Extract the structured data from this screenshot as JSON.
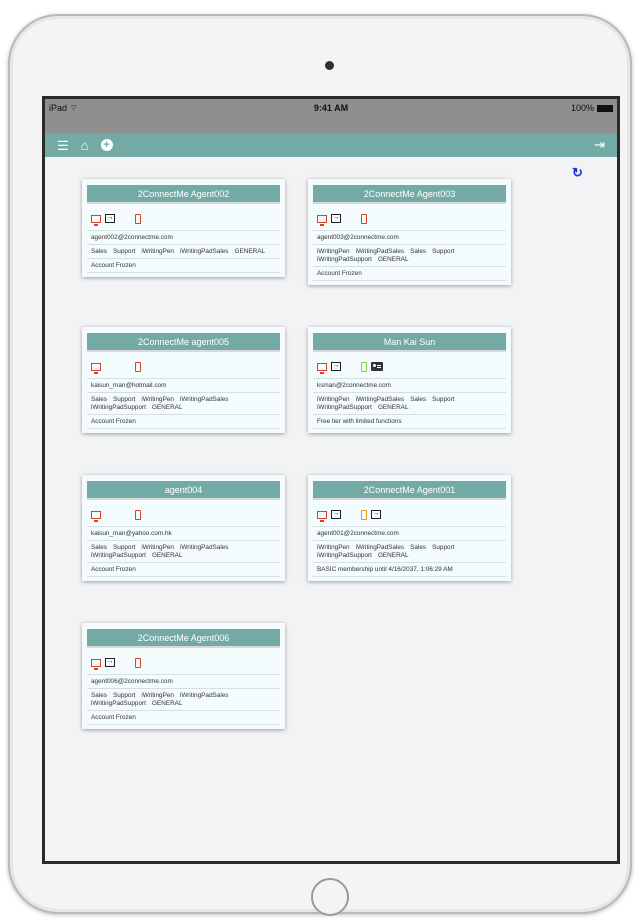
{
  "status_bar": {
    "device": "iPad",
    "time": "9:41 AM",
    "battery": "100%"
  },
  "toolbar": {
    "menu_icon": "menu-icon",
    "home_icon": "home-icon",
    "add_icon": "add-circle-icon",
    "logout_icon": "sign-out-icon"
  },
  "refresh_icon": "refresh-icon",
  "cards": [
    {
      "title": "2ConnectMe Agent002",
      "email": "agent002@2connectme.com",
      "groups": [
        "Sales",
        "Support",
        "iWritingPen",
        "iWritingPadSales",
        "GENERAL"
      ],
      "status": "Account Frozen"
    },
    {
      "title": "2ConnectMe Agent003",
      "email": "agent003@2connectme.com",
      "groups": [
        "iWritingPen",
        "iWritingPadSales",
        "Sales",
        "Support",
        "iWritingPadSupport",
        "GENERAL"
      ],
      "status": "Account Frozen"
    },
    {
      "title": "2ConnectMe agent005",
      "email": "kaisun_man@hotmail.com",
      "groups": [
        "Sales",
        "Support",
        "iWritingPen",
        "iWritingPadSales",
        "iWritingPadSupport",
        "GENERAL"
      ],
      "status": "Account Frozen"
    },
    {
      "title": "Man Kai Sun",
      "email": "ksman@2connectme.com",
      "groups": [
        "iWritingPen",
        "iWritingPadSales",
        "Sales",
        "Support",
        "iWritingPadSupport",
        "GENERAL"
      ],
      "status": "Free tier with limited functions"
    },
    {
      "title": "agent004",
      "email": "kaisun_man@yahoo.com.hk",
      "groups": [
        "Sales",
        "Support",
        "iWritingPen",
        "iWritingPadSales",
        "iWritingPadSupport",
        "GENERAL"
      ],
      "status": "Account Frozen"
    },
    {
      "title": "2ConnectMe Agent001",
      "email": "agent001@2connectme.com",
      "groups": [
        "iWritingPen",
        "iWritingPadSales",
        "Sales",
        "Support",
        "iWritingPadSupport",
        "GENERAL"
      ],
      "status": "BASIC membership until 4/16/2037, 1:06:29 AM"
    },
    {
      "title": "2ConnectMe Agent006",
      "email": "agent006@2connectme.com",
      "groups": [
        "Sales",
        "Support",
        "iWritingPen",
        "iWritingPadSales",
        "iWritingPadSupport",
        "GENERAL"
      ],
      "status": "Account Frozen"
    }
  ],
  "colors": {
    "header": "#74aaa6",
    "desktop_icon": "#d9402a",
    "phone_active": "#7bd24c",
    "phone_busy": "#e6a11b",
    "refresh": "#1f2fd0"
  }
}
